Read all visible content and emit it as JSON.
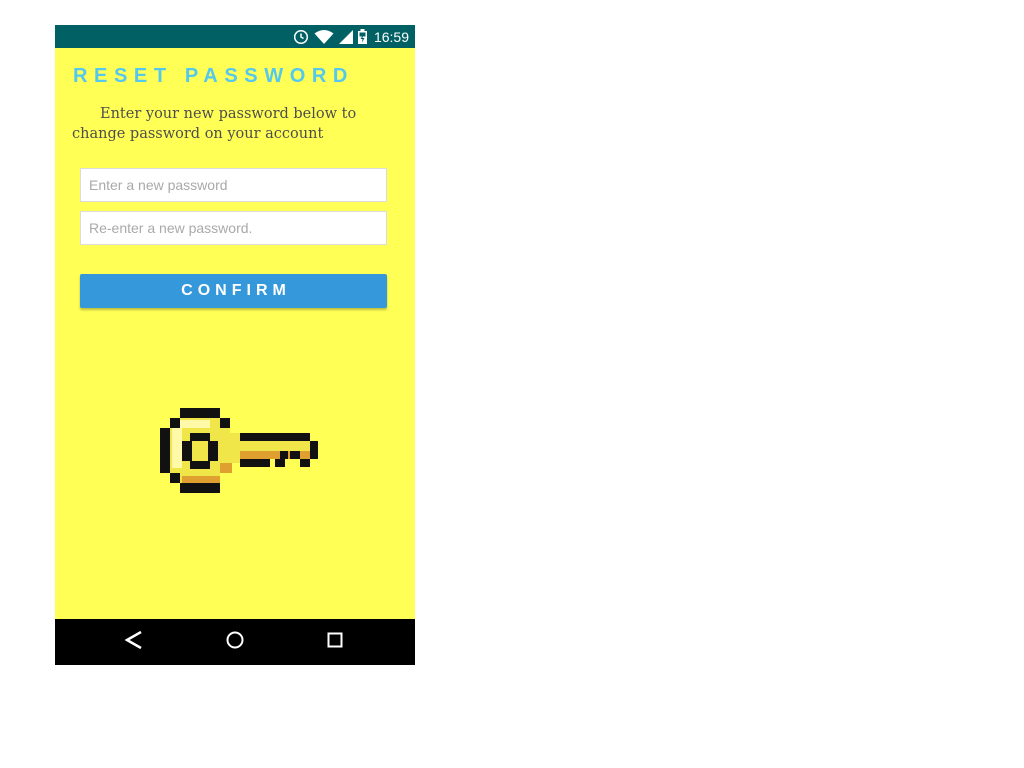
{
  "status_bar": {
    "time": "16:59",
    "icons": [
      "alarm-clock-icon",
      "wifi-icon",
      "cell-signal-icon",
      "battery-charging-icon"
    ]
  },
  "screen": {
    "title": "RESET PASSWORD",
    "description": "Enter your new password below to change password on your account"
  },
  "form": {
    "new_password_placeholder": "Enter a new password",
    "new_password_value": "",
    "confirm_password_placeholder": "Re-enter a new password.",
    "confirm_password_value": "",
    "confirm_label": "CONFIRM"
  },
  "illustration": {
    "icon": "pixel-key-icon"
  },
  "nav_bar": {
    "icons": [
      "back-icon",
      "home-icon",
      "recent-apps-icon"
    ]
  },
  "colors": {
    "status_bar": "#006064",
    "background": "#ffff55",
    "title": "#55c8ee",
    "button": "#3498db",
    "nav_bar": "#000000"
  }
}
